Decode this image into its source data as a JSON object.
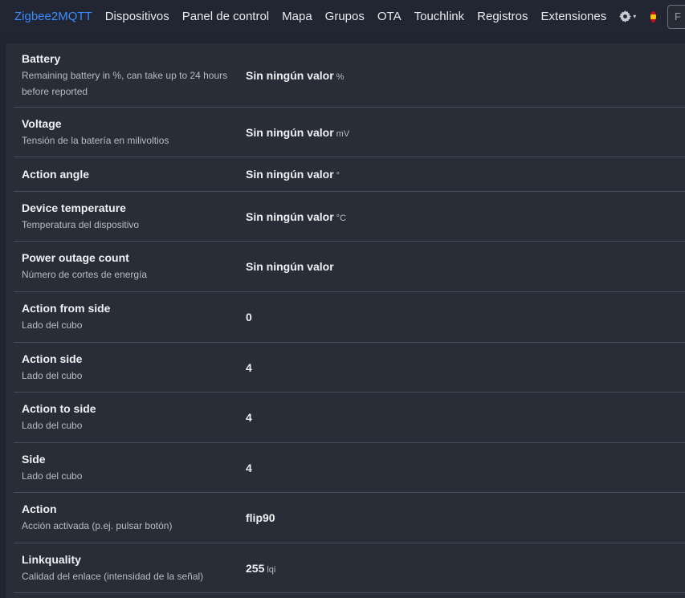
{
  "navbar": {
    "brand": "Zigbee2MQTT",
    "items": [
      {
        "label": "Dispositivos"
      },
      {
        "label": "Panel de control"
      },
      {
        "label": "Mapa"
      },
      {
        "label": "Grupos"
      },
      {
        "label": "OTA"
      },
      {
        "label": "Touchlink"
      },
      {
        "label": "Registros"
      },
      {
        "label": "Extensiones"
      }
    ],
    "settings_icon": "gear-icon",
    "language_icon": "spain-flag-icon",
    "search_fragment": "F"
  },
  "properties": [
    {
      "name": "Battery",
      "description": "Remaining battery in %, can take up to 24 hours before reported",
      "value": "Sin ningún valor",
      "unit": "%"
    },
    {
      "name": "Voltage",
      "description": "Tensión de la batería en milivoltios",
      "value": "Sin ningún valor",
      "unit": "mV"
    },
    {
      "name": "Action angle",
      "description": "",
      "value": "Sin ningún valor",
      "unit": "°"
    },
    {
      "name": "Device temperature",
      "description": "Temperatura del dispositivo",
      "value": "Sin ningún valor",
      "unit": "°C"
    },
    {
      "name": "Power outage count",
      "description": "Número de cortes de energía",
      "value": "Sin ningún valor",
      "unit": ""
    },
    {
      "name": "Action from side",
      "description": "Lado del cubo",
      "value": "0",
      "unit": ""
    },
    {
      "name": "Action side",
      "description": "Lado del cubo",
      "value": "4",
      "unit": ""
    },
    {
      "name": "Action to side",
      "description": "Lado del cubo",
      "value": "4",
      "unit": ""
    },
    {
      "name": "Side",
      "description": "Lado del cubo",
      "value": "4",
      "unit": ""
    },
    {
      "name": "Action",
      "description": "Acción activada (p.ej. pulsar botón)",
      "value": "flip90",
      "unit": ""
    },
    {
      "name": "Linkquality",
      "description": "Calidad del enlace (intensidad de la señal)",
      "value": "255",
      "unit": "lqi"
    }
  ]
}
